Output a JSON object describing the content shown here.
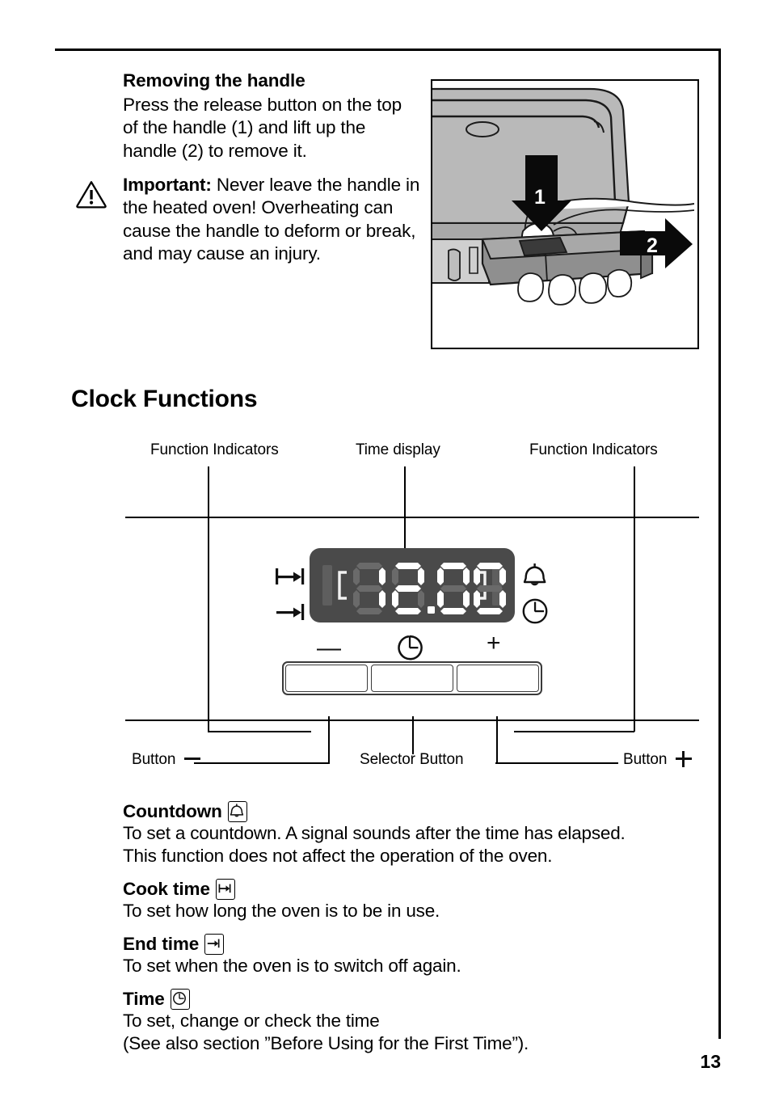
{
  "page": {
    "number": "13"
  },
  "intro": {
    "heading": "Removing the handle",
    "paragraph1": "Press the release button on the top of the handle (1) and lift up the handle (2) to remove it.",
    "important_label": "Important:",
    "paragraph2": " Never leave the handle in the heated oven! Overheating can cause the handle to deform or break, and may cause an injury.",
    "warning_icon": "warning-triangle-icon"
  },
  "illustration": {
    "name": "oven-door-handle-removal-illustration",
    "arrow1_label": "1",
    "arrow2_label": "2"
  },
  "section": {
    "title": "Clock Functions"
  },
  "diagram": {
    "callout_left": "Function Indicators",
    "callout_center": "Time display",
    "callout_right": "Function Indicators",
    "callout_button_minus": "Button",
    "callout_selector": "Selector Button",
    "callout_button_plus": "Button",
    "display_value": "12.00",
    "indicator_icons": {
      "cook_time": "cook-time-icon",
      "end_time": "end-time-icon",
      "countdown": "bell-icon",
      "time": "clock-icon"
    },
    "buttons": {
      "minus_symbol": "—",
      "selector_symbol": "clock-selector-icon",
      "plus_symbol": "+"
    }
  },
  "functions": [
    {
      "title": "Countdown",
      "icon": "bell-icon",
      "lines": [
        "To set a countdown. A signal sounds after the time has elapsed.",
        "This function does not affect the operation of the oven."
      ]
    },
    {
      "title": "Cook time",
      "icon": "cook-time-icon",
      "lines": [
        "To set how long the oven is to be in use."
      ]
    },
    {
      "title": "End time",
      "icon": "end-time-icon",
      "lines": [
        "To set when the oven is to switch off again."
      ]
    },
    {
      "title": "Time",
      "icon": "clock-icon",
      "lines": [
        "To set, change or check the time",
        "(See also section ”Before Using for the First Time”)."
      ]
    }
  ],
  "colors": {
    "display_bg": "#4a4a4a",
    "segment_on": "#ffffff",
    "segment_off": "#5e5e5e",
    "ink": "#000000"
  }
}
